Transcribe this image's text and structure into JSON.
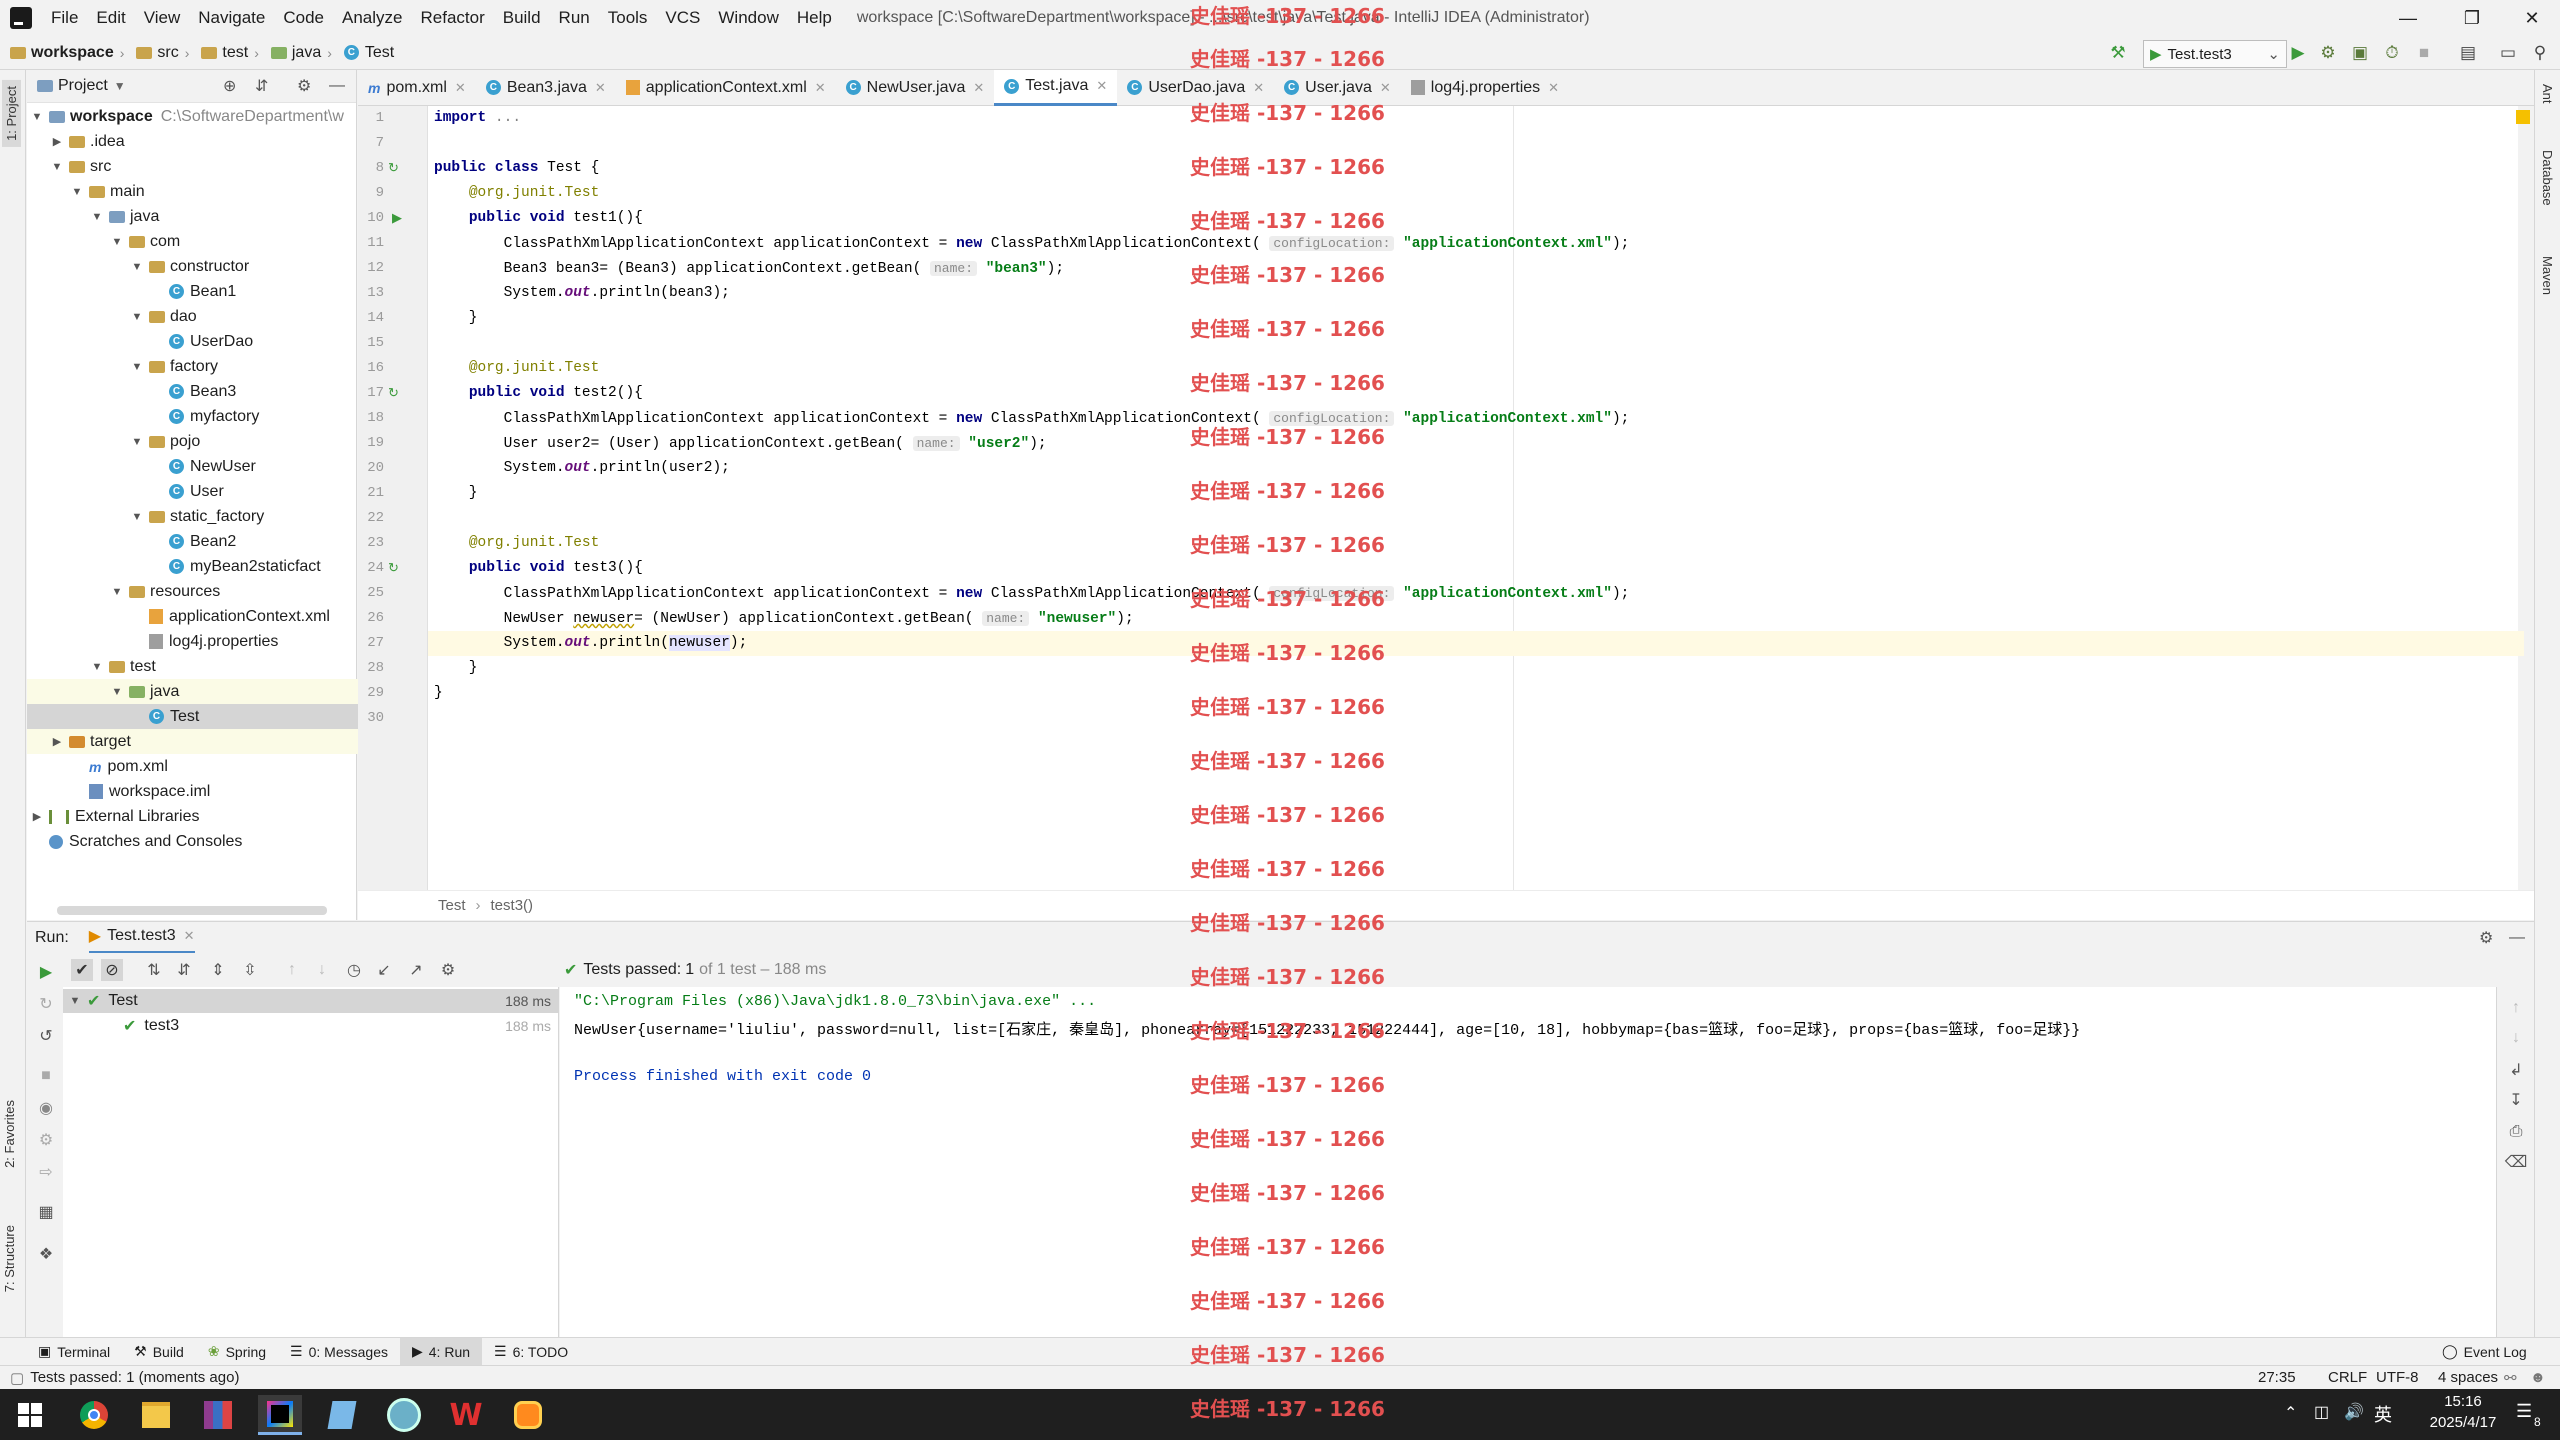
{
  "menubar": {
    "items": [
      "File",
      "Edit",
      "View",
      "Navigate",
      "Code",
      "Analyze",
      "Refactor",
      "Build",
      "Run",
      "Tools",
      "VCS",
      "Window",
      "Help"
    ],
    "title": "workspace [C:\\SoftwareDepartment\\workspace] - ...\\src\\test\\java\\Test.java - IntelliJ IDEA (Administrator)"
  },
  "navbar": {
    "crumbs": [
      "workspace",
      "src",
      "test",
      "java",
      "Test"
    ],
    "run_config": "Test.test3"
  },
  "left_strip": {
    "project_tab": "1: Project",
    "favorites_tab": "2: Favorites",
    "structure_tab": "7: Structure"
  },
  "right_strip": {
    "ant": "Ant",
    "database": "Database",
    "maven": "Maven"
  },
  "project": {
    "header": "Project",
    "tree": [
      {
        "label": "workspace",
        "extra": "C:\\SoftwareDepartment\\w"
      },
      {
        "label": ".idea"
      },
      {
        "label": "src"
      },
      {
        "label": "main"
      },
      {
        "label": "java"
      },
      {
        "label": "com"
      },
      {
        "label": "constructor"
      },
      {
        "label": "Bean1"
      },
      {
        "label": "dao"
      },
      {
        "label": "UserDao"
      },
      {
        "label": "factory"
      },
      {
        "label": "Bean3"
      },
      {
        "label": "myfactory"
      },
      {
        "label": "pojo"
      },
      {
        "label": "NewUser"
      },
      {
        "label": "User"
      },
      {
        "label": "static_factory"
      },
      {
        "label": "Bean2"
      },
      {
        "label": "myBean2staticfact"
      },
      {
        "label": "resources"
      },
      {
        "label": "applicationContext.xml"
      },
      {
        "label": "log4j.properties"
      },
      {
        "label": "test"
      },
      {
        "label": "java"
      },
      {
        "label": "Test"
      },
      {
        "label": "target"
      },
      {
        "label": "pom.xml"
      },
      {
        "label": "workspace.iml"
      },
      {
        "label": "External Libraries"
      },
      {
        "label": "Scratches and Consoles"
      }
    ]
  },
  "editor": {
    "tabs": [
      "pom.xml",
      "Bean3.java",
      "applicationContext.xml",
      "NewUser.java",
      "Test.java",
      "UserDao.java",
      "User.java",
      "log4j.properties"
    ],
    "active_tab": "Test.java",
    "line_numbers": [
      "1",
      "7",
      "8",
      "9",
      "10",
      "11",
      "12",
      "13",
      "14",
      "15",
      "16",
      "17",
      "18",
      "19",
      "20",
      "21",
      "22",
      "23",
      "24",
      "25",
      "26",
      "27",
      "28",
      "29",
      "30"
    ],
    "breadcrumb": [
      "Test",
      "test3()"
    ]
  },
  "run": {
    "label": "Run:",
    "tab": "Test.test3",
    "status": "Tests passed:",
    "status_count": "1",
    "status_rest": "of 1 test – 188 ms",
    "tree": [
      {
        "label": "Test",
        "time": "188 ms"
      },
      {
        "label": "test3",
        "time": "188 ms"
      }
    ],
    "console": [
      "\"C:\\Program Files (x86)\\Java\\jdk1.8.0_73\\bin\\java.exe\" ...",
      "NewUser{username='liuliu', password=null, list=[石家庄, 秦皇岛], phonearray=[151222233, 151222444], age=[10, 18], hobbymap={bas=篮球, foo=足球}, props={bas=篮球, foo=足球}}",
      "",
      "Process finished with exit code 0"
    ]
  },
  "tool_tabs": [
    "Terminal",
    "Build",
    "Spring",
    "0: Messages",
    "4: Run",
    "6: TODO"
  ],
  "event_log": "Event Log",
  "statusbar": {
    "message": "Tests passed: 1 (moments ago)",
    "position": "27:35",
    "line_sep": "CRLF",
    "encoding": "UTF-8",
    "indent": "4 spaces"
  },
  "taskbar": {
    "ime": "英",
    "time": "15:16",
    "date": "2025/4/17",
    "notif": "8"
  },
  "watermark": "史佳瑶 -137 - 1266"
}
